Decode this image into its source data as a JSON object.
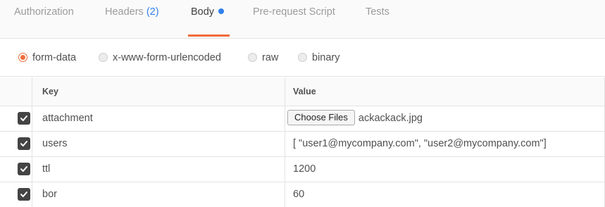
{
  "tabs": [
    {
      "label": "Authorization"
    },
    {
      "label": "Headers",
      "count": "(2)"
    },
    {
      "label": "Body",
      "active": true,
      "indicator": "blue-dot-icon"
    },
    {
      "label": "Pre-request Script"
    },
    {
      "label": "Tests"
    }
  ],
  "body_modes": [
    {
      "label": "form-data",
      "selected": true
    },
    {
      "label": "x-www-form-urlencoded"
    },
    {
      "label": "raw"
    },
    {
      "label": "binary"
    }
  ],
  "table": {
    "headers": {
      "key": "Key",
      "value": "Value"
    },
    "rows": [
      {
        "checked": true,
        "key": "attachment",
        "button": "Choose Files",
        "value": "ackackack.jpg"
      },
      {
        "checked": true,
        "key": "users",
        "value": "[ \"user1@mycompany.com\", \"user2@mycompany.com\"]"
      },
      {
        "checked": true,
        "key": "ttl",
        "value": "1200"
      },
      {
        "checked": true,
        "key": "bor",
        "value": "60"
      }
    ]
  },
  "colors": {
    "accent": "#f26b3a",
    "indicator": "#2f80ed",
    "checkbox": "#444444"
  }
}
